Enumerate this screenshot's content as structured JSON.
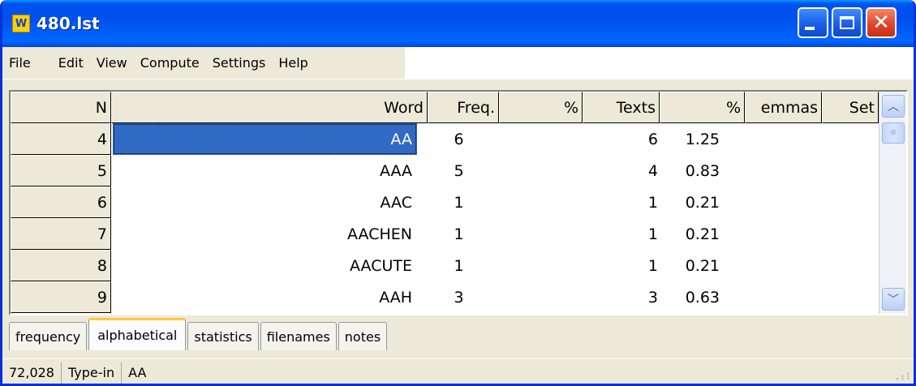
{
  "window": {
    "title": "480.lst",
    "icon_text": "W"
  },
  "menu": [
    "File",
    "Edit",
    "View",
    "Compute",
    "Settings",
    "Help"
  ],
  "columns": [
    "N",
    "Word",
    "Freq.",
    "%",
    "Texts",
    "%",
    "emmas",
    "Set"
  ],
  "rows": [
    {
      "n": "4",
      "word": "AA",
      "freq": "6",
      "pct": "",
      "texts": "6",
      "tpct": "1.25",
      "lemmas": "",
      "set": ""
    },
    {
      "n": "5",
      "word": "AAA",
      "freq": "5",
      "pct": "",
      "texts": "4",
      "tpct": "0.83",
      "lemmas": "",
      "set": ""
    },
    {
      "n": "6",
      "word": "AAC",
      "freq": "1",
      "pct": "",
      "texts": "1",
      "tpct": "0.21",
      "lemmas": "",
      "set": ""
    },
    {
      "n": "7",
      "word": "AACHEN",
      "freq": "1",
      "pct": "",
      "texts": "1",
      "tpct": "0.21",
      "lemmas": "",
      "set": ""
    },
    {
      "n": "8",
      "word": "AACUTE",
      "freq": "1",
      "pct": "",
      "texts": "1",
      "tpct": "0.21",
      "lemmas": "",
      "set": ""
    },
    {
      "n": "9",
      "word": "AAH",
      "freq": "3",
      "pct": "",
      "texts": "3",
      "tpct": "0.63",
      "lemmas": "",
      "set": ""
    }
  ],
  "selected_row": 0,
  "tabs": [
    "frequency",
    "alphabetical",
    "statistics",
    "filenames",
    "notes"
  ],
  "active_tab": "alphabetical",
  "status": {
    "count": "72,028",
    "mode": "Type-in",
    "value": "AA"
  },
  "colors": {
    "titlebar": "#0053ee",
    "selection": "#316ac5",
    "active_tab_accent": "#ffc83c"
  }
}
